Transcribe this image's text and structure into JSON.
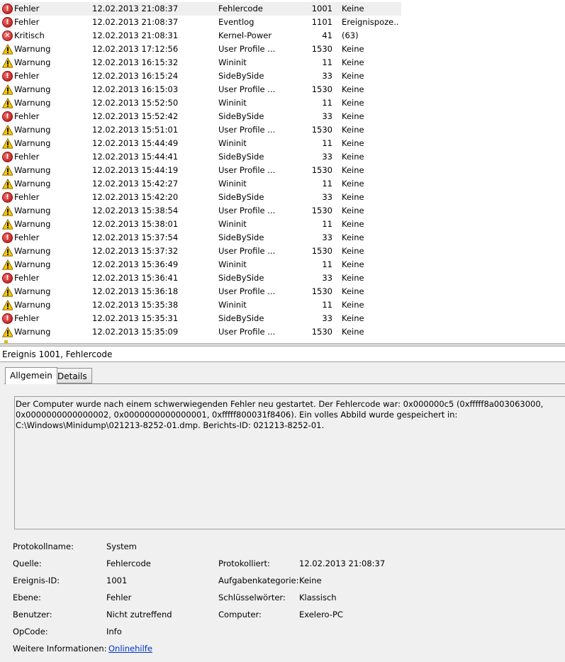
{
  "events": [
    {
      "level": "Fehler",
      "date": "12.02.2013 21:08:37",
      "source": "Fehlercode",
      "id": "1001",
      "category": "Keine",
      "icon": "error-icon",
      "selected": true
    },
    {
      "level": "Fehler",
      "date": "12.02.2013 21:08:37",
      "source": "Eventlog",
      "id": "1101",
      "category": "Ereignispoze...",
      "icon": "error-icon"
    },
    {
      "level": "Kritisch",
      "date": "12.02.2013 21:08:31",
      "source": "Kernel-Power",
      "id": "41",
      "category": "(63)",
      "icon": "critical-icon"
    },
    {
      "level": "Warnung",
      "date": "12.02.2013 17:12:56",
      "source": "User Profile ...",
      "id": "1530",
      "category": "Keine",
      "icon": "warning-icon"
    },
    {
      "level": "Warnung",
      "date": "12.02.2013 16:15:32",
      "source": "Wininit",
      "id": "11",
      "category": "Keine",
      "icon": "warning-icon"
    },
    {
      "level": "Fehler",
      "date": "12.02.2013 16:15:24",
      "source": "SideBySide",
      "id": "33",
      "category": "Keine",
      "icon": "error-icon"
    },
    {
      "level": "Warnung",
      "date": "12.02.2013 16:15:03",
      "source": "User Profile ...",
      "id": "1530",
      "category": "Keine",
      "icon": "warning-icon"
    },
    {
      "level": "Warnung",
      "date": "12.02.2013 15:52:50",
      "source": "Wininit",
      "id": "11",
      "category": "Keine",
      "icon": "warning-icon"
    },
    {
      "level": "Fehler",
      "date": "12.02.2013 15:52:42",
      "source": "SideBySide",
      "id": "33",
      "category": "Keine",
      "icon": "error-icon"
    },
    {
      "level": "Warnung",
      "date": "12.02.2013 15:51:01",
      "source": "User Profile ...",
      "id": "1530",
      "category": "Keine",
      "icon": "warning-icon"
    },
    {
      "level": "Warnung",
      "date": "12.02.2013 15:44:49",
      "source": "Wininit",
      "id": "11",
      "category": "Keine",
      "icon": "warning-icon"
    },
    {
      "level": "Fehler",
      "date": "12.02.2013 15:44:41",
      "source": "SideBySide",
      "id": "33",
      "category": "Keine",
      "icon": "error-icon"
    },
    {
      "level": "Warnung",
      "date": "12.02.2013 15:44:19",
      "source": "User Profile ...",
      "id": "1530",
      "category": "Keine",
      "icon": "warning-icon"
    },
    {
      "level": "Warnung",
      "date": "12.02.2013 15:42:27",
      "source": "Wininit",
      "id": "11",
      "category": "Keine",
      "icon": "warning-icon"
    },
    {
      "level": "Fehler",
      "date": "12.02.2013 15:42:20",
      "source": "SideBySide",
      "id": "33",
      "category": "Keine",
      "icon": "error-icon"
    },
    {
      "level": "Warnung",
      "date": "12.02.2013 15:38:54",
      "source": "User Profile ...",
      "id": "1530",
      "category": "Keine",
      "icon": "warning-icon"
    },
    {
      "level": "Warnung",
      "date": "12.02.2013 15:38:01",
      "source": "Wininit",
      "id": "11",
      "category": "Keine",
      "icon": "warning-icon"
    },
    {
      "level": "Fehler",
      "date": "12.02.2013 15:37:54",
      "source": "SideBySide",
      "id": "33",
      "category": "Keine",
      "icon": "error-icon"
    },
    {
      "level": "Warnung",
      "date": "12.02.2013 15:37:32",
      "source": "User Profile ...",
      "id": "1530",
      "category": "Keine",
      "icon": "warning-icon"
    },
    {
      "level": "Warnung",
      "date": "12.02.2013 15:36:49",
      "source": "Wininit",
      "id": "11",
      "category": "Keine",
      "icon": "warning-icon"
    },
    {
      "level": "Fehler",
      "date": "12.02.2013 15:36:41",
      "source": "SideBySide",
      "id": "33",
      "category": "Keine",
      "icon": "error-icon"
    },
    {
      "level": "Warnung",
      "date": "12.02.2013 15:36:18",
      "source": "User Profile ...",
      "id": "1530",
      "category": "Keine",
      "icon": "warning-icon"
    },
    {
      "level": "Warnung",
      "date": "12.02.2013 15:35:38",
      "source": "Wininit",
      "id": "11",
      "category": "Keine",
      "icon": "warning-icon"
    },
    {
      "level": "Fehler",
      "date": "12.02.2013 15:35:31",
      "source": "SideBySide",
      "id": "33",
      "category": "Keine",
      "icon": "error-icon"
    },
    {
      "level": "Warnung",
      "date": "12.02.2013 15:35:09",
      "source": "User Profile ...",
      "id": "1530",
      "category": "Keine",
      "icon": "warning-icon"
    }
  ],
  "detail": {
    "header": "Ereignis 1001, Fehlercode",
    "tabs": {
      "general": "Allgemein",
      "details": "Details"
    },
    "description": "Der Computer wurde nach einem schwerwiegenden Fehler neu gestartet. Der Fehlercode war: 0x000000c5 (0xfffff8a003063000, 0x0000000000000002, 0x0000000000000001, 0xfffff800031f8406). Ein volles Abbild wurde gespeichert in: C:\\Windows\\Minidump\\021213-8252-01.dmp. Berichts-ID: 021213-8252-01.",
    "props": {
      "log_name": {
        "label": "Protokollname:",
        "value": "System"
      },
      "source": {
        "label": "Quelle:",
        "value": "Fehlercode"
      },
      "logged": {
        "label": "Protokolliert:",
        "value": "12.02.2013 21:08:37"
      },
      "event_id": {
        "label": "Ereignis-ID:",
        "value": "1001"
      },
      "task_category": {
        "label": "Aufgabenkategorie:",
        "value": "Keine"
      },
      "level": {
        "label": "Ebene:",
        "value": "Fehler"
      },
      "keywords": {
        "label": "Schlüsselwörter:",
        "value": "Klassisch"
      },
      "user": {
        "label": "Benutzer:",
        "value": "Nicht zutreffend"
      },
      "computer": {
        "label": "Computer:",
        "value": "Exelero-PC"
      },
      "opcode": {
        "label": "OpCode:",
        "value": "Info"
      },
      "more_info": {
        "label": "Weitere Informationen:",
        "value": "Onlinehilfe"
      }
    }
  },
  "colors": {
    "selection": "#efefef",
    "error": "#c01818",
    "warning": "#f2c200",
    "link": "#0033cc",
    "pane": "#f0f0f0"
  }
}
